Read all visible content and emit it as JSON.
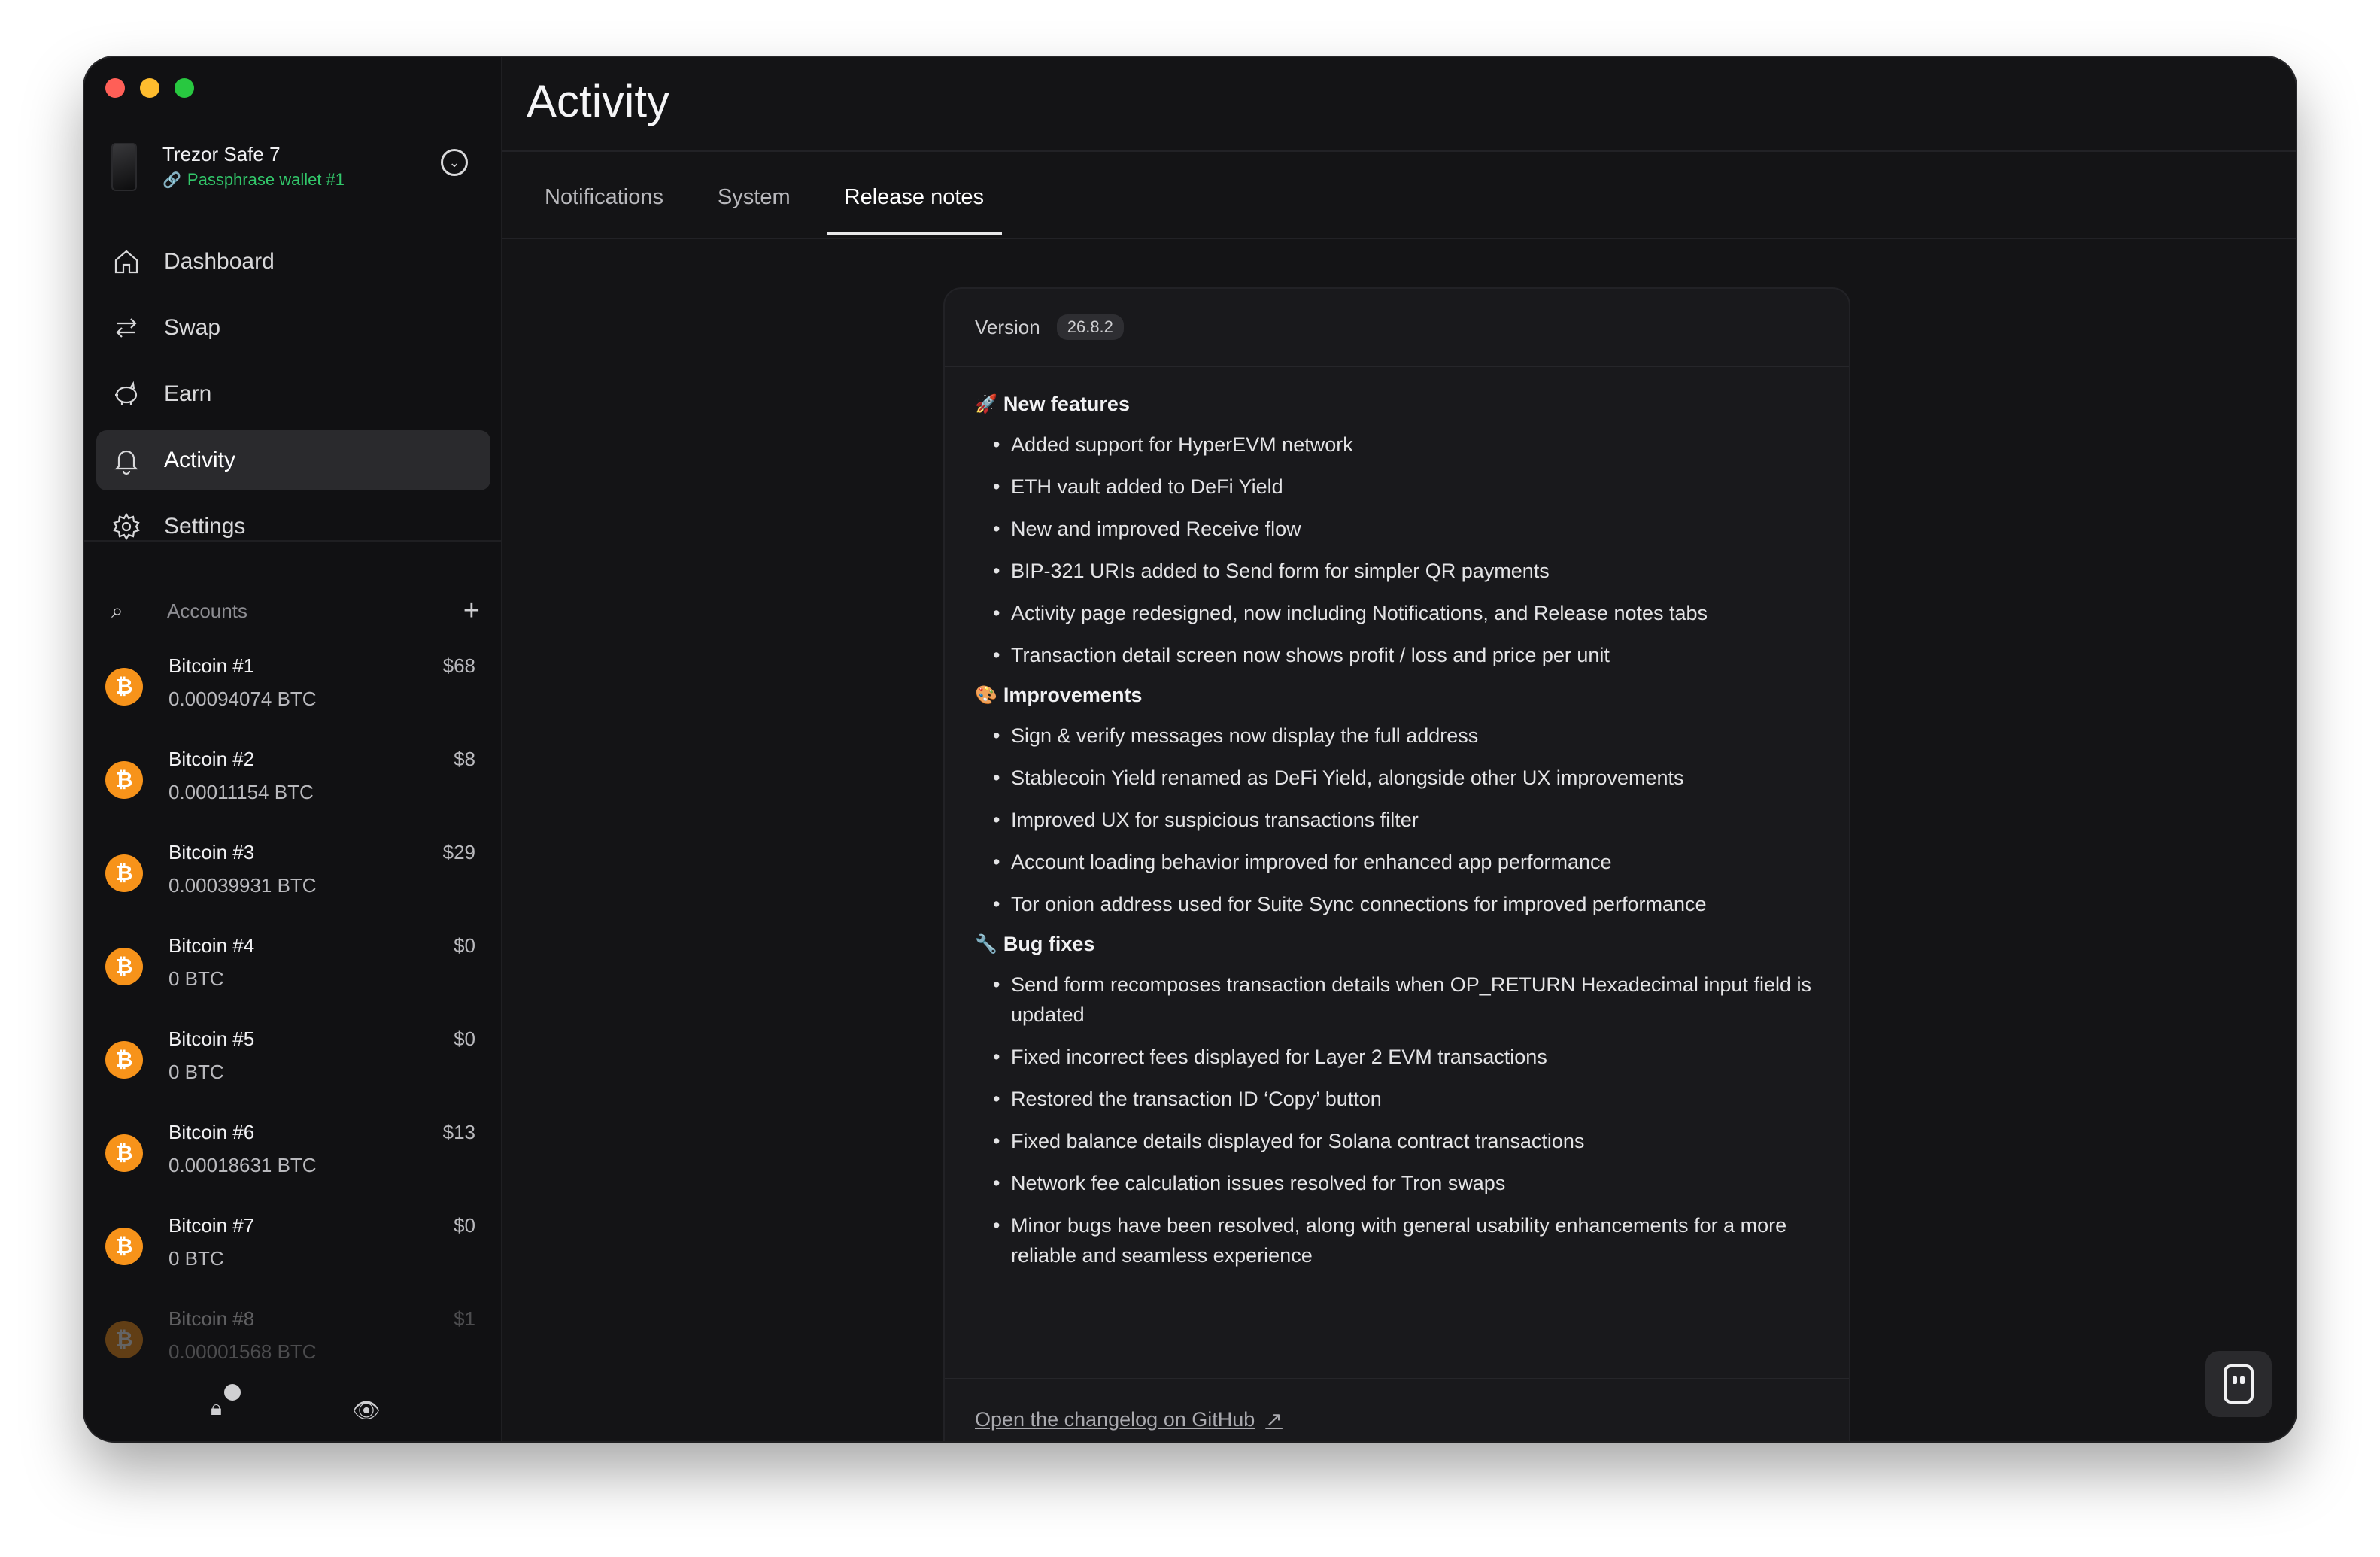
{
  "device": {
    "name": "Trezor Safe 7",
    "wallet": "Passphrase wallet #1"
  },
  "nav": [
    {
      "label": "Dashboard",
      "icon": "home-icon"
    },
    {
      "label": "Swap",
      "icon": "swap-icon"
    },
    {
      "label": "Earn",
      "icon": "piggy-bank-icon"
    },
    {
      "label": "Activity",
      "icon": "bell-icon",
      "active": true
    },
    {
      "label": "Settings",
      "icon": "gear-icon"
    }
  ],
  "accounts": {
    "header": "Accounts",
    "items": [
      {
        "name": "Bitcoin #1",
        "fiat": "$68",
        "balance": "0.00094074 BTC"
      },
      {
        "name": "Bitcoin #2",
        "fiat": "$8",
        "balance": "0.00011154 BTC"
      },
      {
        "name": "Bitcoin #3",
        "fiat": "$29",
        "balance": "0.00039931 BTC"
      },
      {
        "name": "Bitcoin #4",
        "fiat": "$0",
        "balance": "0 BTC"
      },
      {
        "name": "Bitcoin #5",
        "fiat": "$0",
        "balance": "0 BTC"
      },
      {
        "name": "Bitcoin #6",
        "fiat": "$13",
        "balance": "0.00018631 BTC"
      },
      {
        "name": "Bitcoin #7",
        "fiat": "$0",
        "balance": "0 BTC"
      },
      {
        "name": "Bitcoin #8",
        "fiat": "$1",
        "balance": "0.00001568 BTC"
      }
    ]
  },
  "page": {
    "title": "Activity",
    "tabs": [
      "Notifications",
      "System",
      "Release notes"
    ],
    "active_tab": "Release notes"
  },
  "release": {
    "version_label": "Version",
    "version": "26.8.2",
    "sections": [
      {
        "emoji": "🚀",
        "title": "New features",
        "items": [
          "Added support for HyperEVM network",
          "ETH vault added to DeFi Yield",
          "New and improved Receive flow",
          "BIP-321 URIs added to Send form for simpler QR payments",
          "Activity page redesigned, now including Notifications, and Release notes tabs",
          "Transaction detail screen now shows profit / loss and price per unit"
        ]
      },
      {
        "emoji": "🎨",
        "title": "Improvements",
        "items": [
          "Sign & verify messages now display the full address",
          "Stablecoin Yield renamed as DeFi Yield, alongside other UX improvements",
          "Improved UX for suspicious transactions filter",
          "Account loading behavior improved for enhanced app performance",
          "Tor onion address used for Suite Sync connections for improved performance"
        ]
      },
      {
        "emoji": "🔧",
        "title": "Bug fixes",
        "items": [
          "Send form recomposes transaction details when OP_RETURN Hexadecimal input field is updated",
          "Fixed incorrect fees displayed for Layer 2 EVM transactions",
          "Restored the transaction ID ‘Copy’ button",
          "Fixed balance details displayed for Solana contract transactions",
          "Network fee calculation issues resolved for Tron swaps",
          "Minor bugs have been resolved, along with general usability enhancements for a more reliable and seamless experience"
        ]
      }
    ],
    "changelog_link": "Open the changelog on GitHub"
  }
}
